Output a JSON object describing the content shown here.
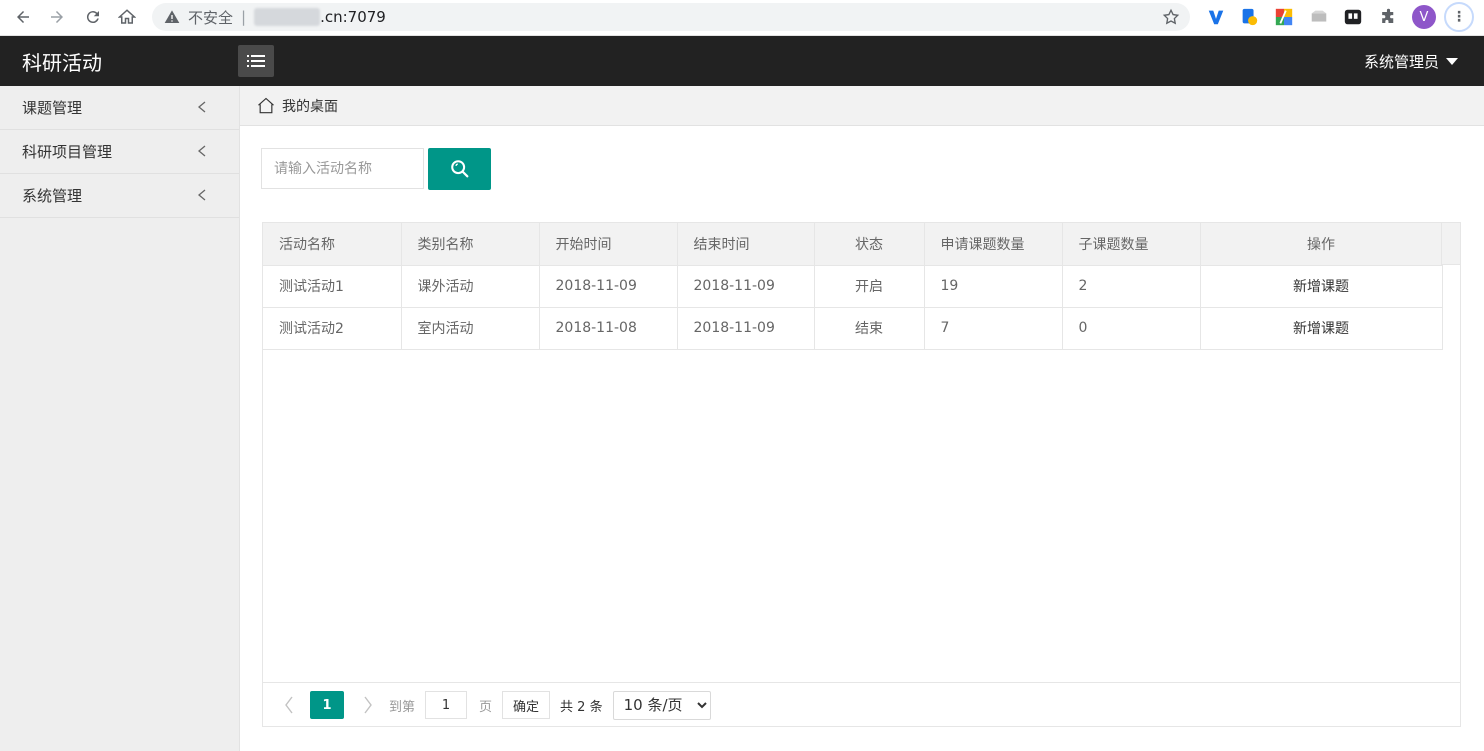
{
  "browser": {
    "security_label": "不安全",
    "url_suffix": ".cn:7079",
    "profile_initial": "V"
  },
  "header": {
    "title": "科研活动",
    "user": "系统管理员"
  },
  "sidebar": {
    "items": [
      {
        "label": "课题管理"
      },
      {
        "label": "科研项目管理"
      },
      {
        "label": "系统管理"
      }
    ]
  },
  "breadcrumb": {
    "label": "我的桌面"
  },
  "search": {
    "placeholder": "请输入活动名称"
  },
  "table": {
    "columns": [
      "活动名称",
      "类别名称",
      "开始时间",
      "结束时间",
      "状态",
      "申请课题数量",
      "子课题数量",
      "操作"
    ],
    "rows": [
      {
        "name": "测试活动1",
        "category": "课外活动",
        "start": "2018-11-09",
        "end": "2018-11-09",
        "status": "开启",
        "applied": "19",
        "sub": "2",
        "action": "新增课题"
      },
      {
        "name": "测试活动2",
        "category": "室内活动",
        "start": "2018-11-08",
        "end": "2018-11-09",
        "status": "结束",
        "applied": "7",
        "sub": "0",
        "action": "新增课题"
      }
    ]
  },
  "pagination": {
    "current": "1",
    "goto_label": "到第",
    "page_input": "1",
    "page_label": "页",
    "confirm": "确定",
    "total": "共 2 条",
    "page_size": "10 条/页"
  },
  "colors": {
    "accent": "#009688",
    "header_bg": "#222222",
    "sidebar_bg": "#eeeeee"
  }
}
